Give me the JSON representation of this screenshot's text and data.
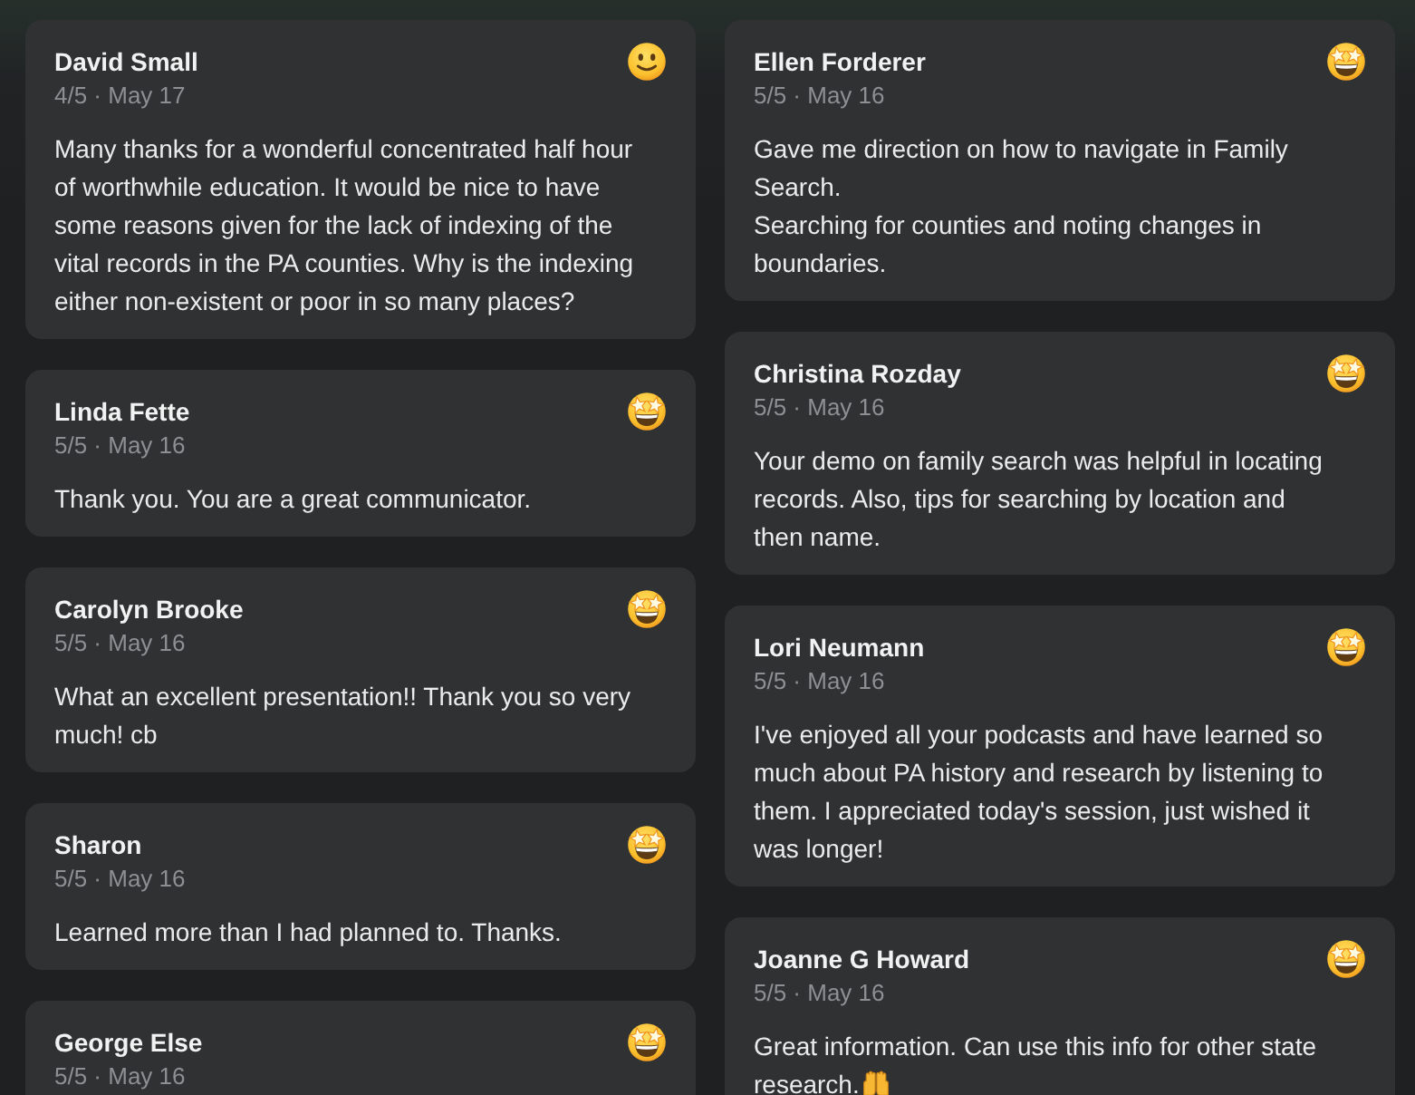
{
  "columns": [
    {
      "reviews": [
        {
          "name": "David Small",
          "meta": "4/5 · May 17",
          "kind": "smiling",
          "comment": "Many thanks for a wonderful concentrated half hour of worthwhile education. It would be nice to have some reasons given for the lack of indexing of the vital records in the PA counties. Why is the indexing either non-existent or poor in so many places?",
          "trailing_emoji": false
        },
        {
          "name": "Linda Fette",
          "meta": "5/5 · May 16",
          "kind": "star-struck",
          "comment": "Thank you. You are a great communicator.",
          "trailing_emoji": false
        },
        {
          "name": "Carolyn Brooke",
          "meta": "5/5 · May 16",
          "kind": "star-struck",
          "comment": "What an excellent presentation!! Thank you so very much! cb",
          "trailing_emoji": false
        },
        {
          "name": "Sharon",
          "meta": "5/5 · May 16",
          "kind": "star-struck",
          "comment": "Learned more than I had planned to. Thanks.",
          "trailing_emoji": false
        },
        {
          "name": "George Else",
          "meta": "5/5 · May 16",
          "kind": "star-struck"
        }
      ]
    },
    {
      "reviews": [
        {
          "name": "Ellen Forderer",
          "meta": "5/5 · May 16",
          "kind": "star-struck",
          "comment": "Gave me direction on how to navigate in Family Search.\nSearching for counties and noting changes in boundaries.",
          "trailing_emoji": false
        },
        {
          "name": "Christina Rozday",
          "meta": "5/5 · May 16",
          "kind": "star-struck",
          "comment": "Your demo on family search was helpful in locating records. Also, tips for searching by location and then name.",
          "trailing_emoji": false
        },
        {
          "name": "Lori Neumann",
          "meta": "5/5 · May 16",
          "kind": "star-struck",
          "comment": "I've enjoyed all your podcasts and have learned so much about PA history and research by listening to them. I appreciated today's session, just wished it was longer!",
          "trailing_emoji": false
        },
        {
          "name": "Joanne G Howard",
          "meta": "5/5 · May 16",
          "kind": "star-struck",
          "comment": "Great information. Can use this info for other state research.",
          "trailing_emoji": true
        }
      ]
    }
  ]
}
